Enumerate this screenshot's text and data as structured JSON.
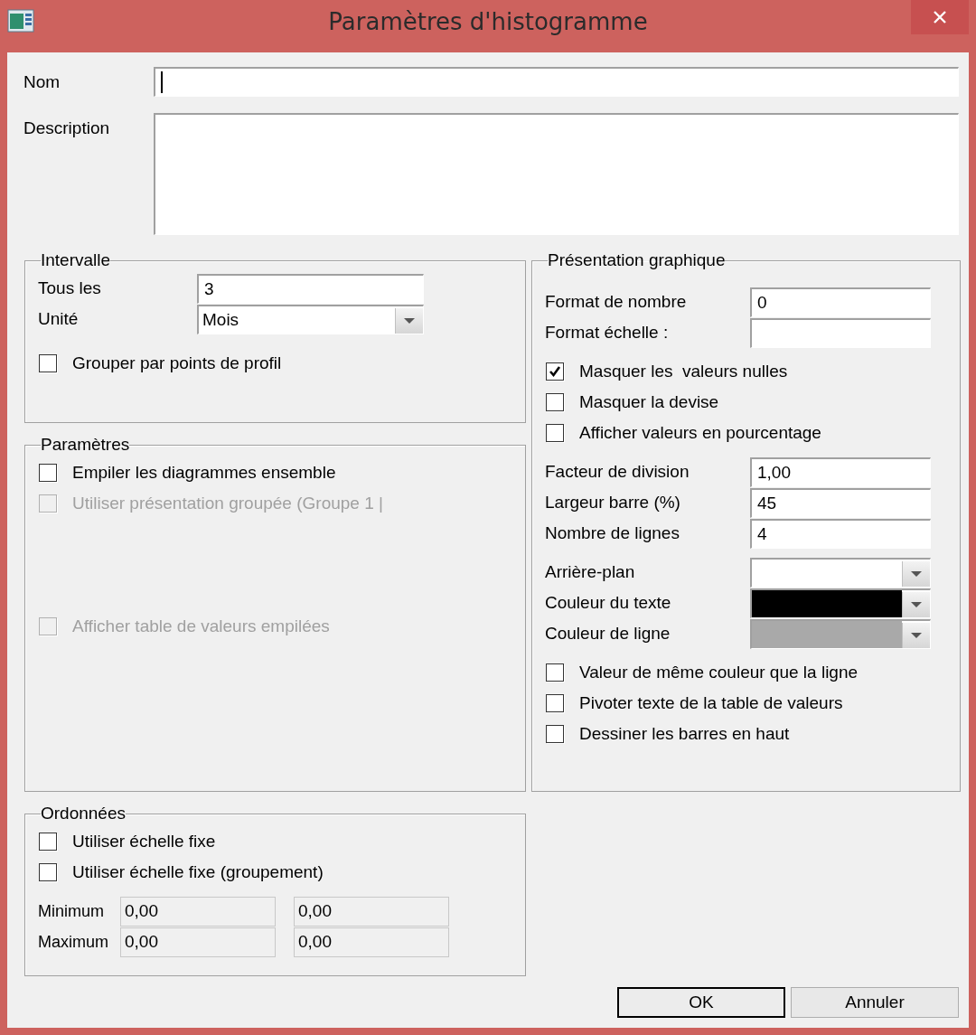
{
  "window": {
    "title": "Paramètres d'histogramme"
  },
  "name_field": {
    "label": "Nom",
    "focused": true
  },
  "description_field": {
    "label": "Description"
  },
  "interval": {
    "title": "Intervalle",
    "fields": [
      {
        "kind": "text",
        "label": "Tous les",
        "value": "3"
      },
      {
        "kind": "dropdown",
        "label": "Unité",
        "value": "Mois"
      }
    ],
    "checkboxes": [
      {
        "label": "Grouper par points de profil",
        "checked": false,
        "disabled": false
      }
    ]
  },
  "parameters": {
    "title": "Paramètres",
    "checkboxes": [
      {
        "label": "Empiler les diagrammes ensemble",
        "checked": false,
        "disabled": false
      },
      {
        "label": "Utiliser présentation groupée (Groupe 1 |",
        "checked": false,
        "disabled": true
      }
    ],
    "bottom_checkboxes": [
      {
        "label": "Afficher table de valeurs empilées",
        "checked": false,
        "disabled": true
      }
    ]
  },
  "ordinates": {
    "title": "Ordonnées",
    "checkboxes": [
      {
        "label": "Utiliser échelle fixe",
        "checked": false,
        "disabled": false
      },
      {
        "label": "Utiliser échelle fixe (groupement)",
        "checked": false,
        "disabled": false
      }
    ],
    "rows": [
      {
        "label": "Minimum",
        "values": [
          "0,00",
          "0,00"
        ]
      },
      {
        "label": "Maximum",
        "values": [
          "0,00",
          "0,00"
        ]
      }
    ]
  },
  "presentation": {
    "title": "Présentation graphique",
    "sections": [
      {
        "items": [
          {
            "kind": "text",
            "label": "Format de nombre",
            "value": "0"
          },
          {
            "kind": "text",
            "label": "Format échelle :"
          }
        ]
      },
      {
        "items": [
          {
            "kind": "checkbox",
            "label": "Masquer les  valeurs nulles",
            "checked": true
          },
          {
            "kind": "checkbox",
            "label": "Masquer la devise",
            "checked": false
          },
          {
            "kind": "checkbox",
            "label": "Afficher valeurs en pourcentage",
            "checked": false
          }
        ]
      },
      {
        "items": [
          {
            "kind": "text",
            "label": "Facteur de division",
            "value": "1,00"
          },
          {
            "kind": "text",
            "label": "Largeur barre (%)",
            "value": "45"
          },
          {
            "kind": "text",
            "label": "Nombre de lignes",
            "value": "4"
          }
        ]
      },
      {
        "items": [
          {
            "kind": "color",
            "label": "Arrière-plan",
            "color": "#ffffff"
          },
          {
            "kind": "color",
            "label": "Couleur du texte",
            "color": "#000000"
          },
          {
            "kind": "color",
            "label": "Couleur de ligne",
            "color": "#a9a9a9"
          }
        ]
      },
      {
        "items": [
          {
            "kind": "checkbox",
            "label": "Valeur de même couleur que la ligne",
            "checked": false
          },
          {
            "kind": "checkbox",
            "label": "Pivoter texte de la table de valeurs",
            "checked": false
          },
          {
            "kind": "checkbox",
            "label": "Dessiner les barres en haut",
            "checked": false
          }
        ]
      }
    ]
  },
  "buttons": [
    {
      "label": "OK",
      "default": true
    },
    {
      "label": "Annuler",
      "default": false
    }
  ]
}
